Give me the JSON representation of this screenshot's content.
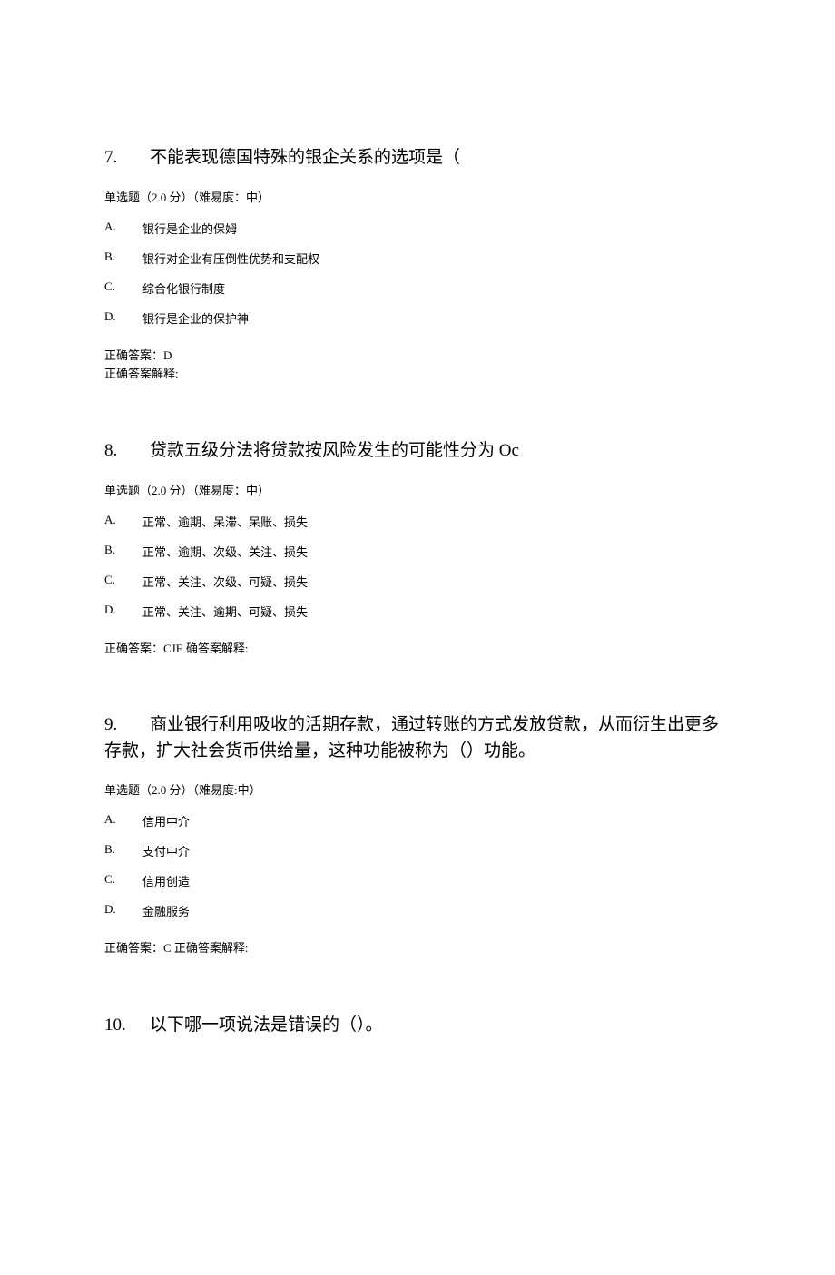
{
  "questions": [
    {
      "number": "7.",
      "title": "不能表现德国特殊的银企关系的选项是（",
      "meta": "单选题（2.0 分）（难易度：中）",
      "options": [
        {
          "letter": "A.",
          "text": "银行是企业的保姆"
        },
        {
          "letter": "B.",
          "text": "银行对企业有压倒性优势和支配权"
        },
        {
          "letter": "C.",
          "text": "综合化银行制度"
        },
        {
          "letter": "D.",
          "text": "银行是企业的保护神"
        }
      ],
      "answer_line1": "正确答案：D",
      "answer_line2": "正确答案解释:"
    },
    {
      "number": "8.",
      "title": "贷款五级分法将贷款按风险发生的可能性分为 Oc",
      "meta": "单选题（2.0 分）（难易度：中）",
      "options": [
        {
          "letter": "A.",
          "text": "正常、逾期、呆滞、呆账、损失"
        },
        {
          "letter": "B.",
          "text": "正常、逾期、次级、关注、损失"
        },
        {
          "letter": "C.",
          "text": "正常、关注、次级、可疑、损失"
        },
        {
          "letter": "D.",
          "text": "正常、关注、逾期、可疑、损失"
        }
      ],
      "answer_line1": "正确答案：CJE 确答案解释:",
      "answer_line2": ""
    },
    {
      "number": "9.",
      "title": "商业银行利用吸收的活期存款，通过转账的方式发放贷款，从而衍生出更多存款，扩大社会货币供给量，这种功能被称为（）功能。",
      "meta": "单选题（2.0 分）（难易度:中）",
      "options": [
        {
          "letter": "A.",
          "text": "信用中介"
        },
        {
          "letter": "B.",
          "text": "支付中介"
        },
        {
          "letter": "C.",
          "text": "信用创造"
        },
        {
          "letter": "D.",
          "text": "金融服务"
        }
      ],
      "answer_line1": "正确答案：C 正确答案解释:",
      "answer_line2": ""
    },
    {
      "number": "10.",
      "title": "以下哪一项说法是错误的（）。",
      "meta": "",
      "options": [],
      "answer_line1": "",
      "answer_line2": ""
    }
  ]
}
